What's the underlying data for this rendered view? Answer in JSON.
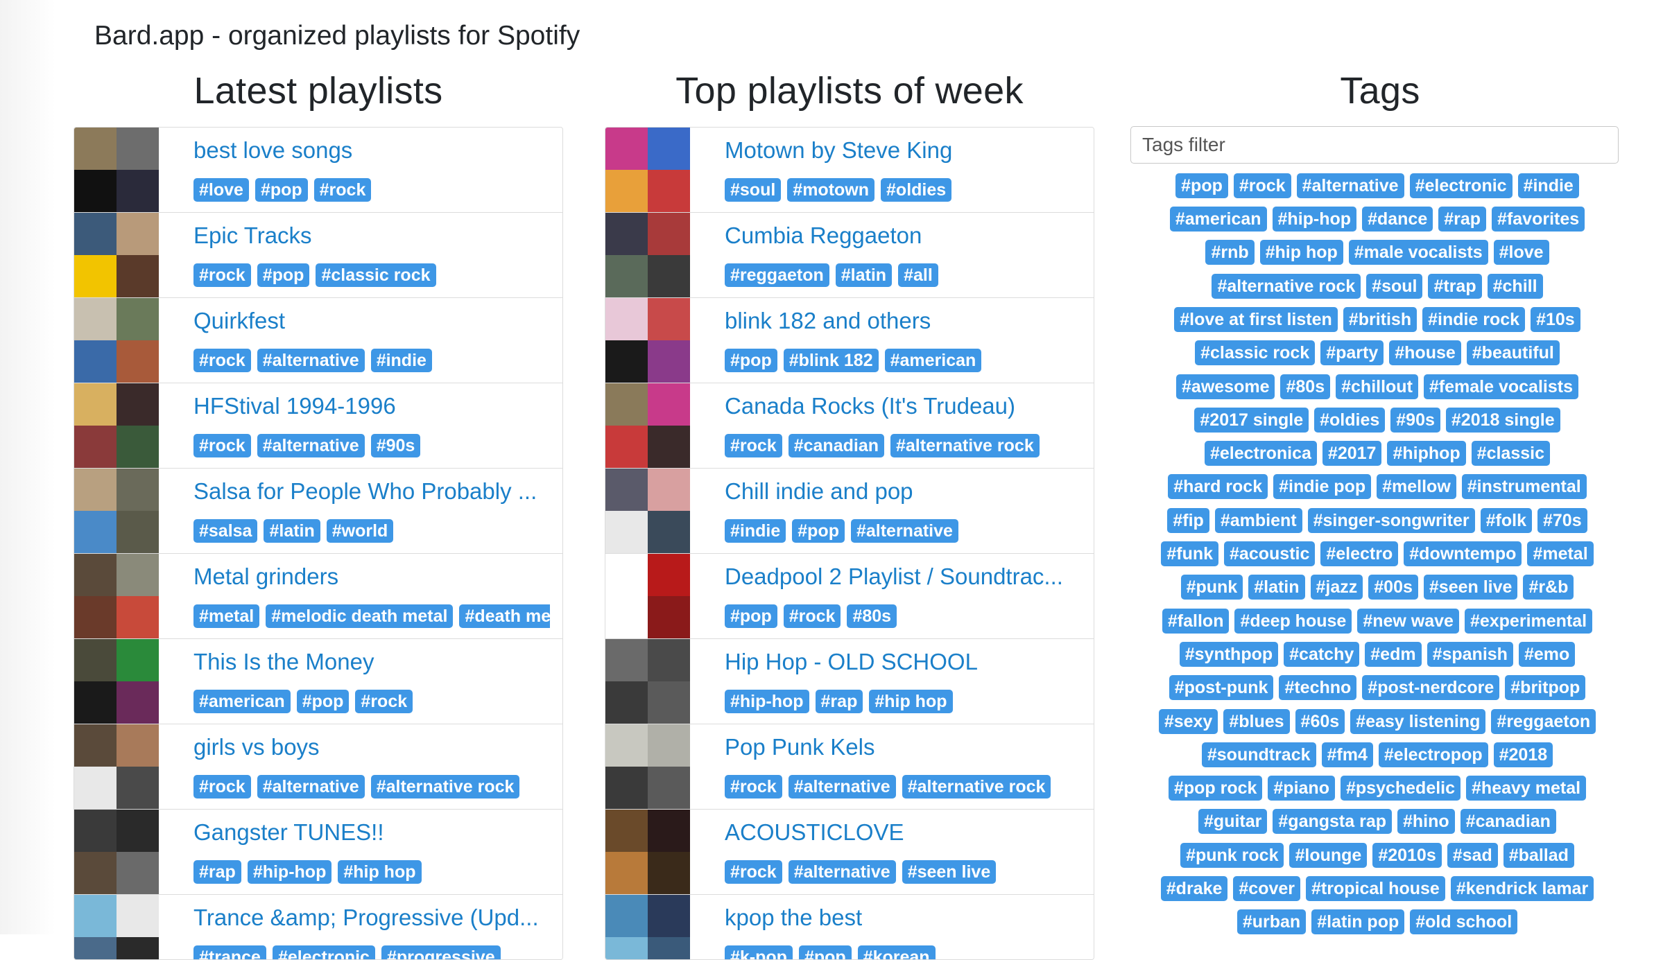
{
  "app": {
    "brand": "Bard.app - organized playlists for Spotify"
  },
  "latest": {
    "title": "Latest playlists",
    "items": [
      {
        "title": "best love songs",
        "tags": [
          "#love",
          "#pop",
          "#rock"
        ],
        "colors": [
          "#8c7a5a",
          "#6d6d6d",
          "#111111",
          "#2a2a3a"
        ]
      },
      {
        "title": "Epic Tracks",
        "tags": [
          "#rock",
          "#pop",
          "#classic rock"
        ],
        "colors": [
          "#3c5a7a",
          "#b89a7a",
          "#f2c400",
          "#5a3a2a"
        ]
      },
      {
        "title": "Quirkfest",
        "tags": [
          "#rock",
          "#alternative",
          "#indie"
        ],
        "colors": [
          "#c8c0b0",
          "#6a7a5a",
          "#3a6aa8",
          "#a85a3a"
        ]
      },
      {
        "title": "HFStival 1994-1996",
        "tags": [
          "#rock",
          "#alternative",
          "#90s"
        ],
        "colors": [
          "#d8b060",
          "#3a2a2a",
          "#8a3a3a",
          "#3a5a3a"
        ]
      },
      {
        "title": "Salsa for People Who Probably ...",
        "tags": [
          "#salsa",
          "#latin",
          "#world"
        ],
        "colors": [
          "#b8a080",
          "#6a6a5a",
          "#4a8ac8",
          "#5a5a4a"
        ]
      },
      {
        "title": "Metal grinders",
        "tags": [
          "#metal",
          "#melodic death metal",
          "#death metal"
        ],
        "colors": [
          "#5a4a3a",
          "#8a8a7a",
          "#6a3a2a",
          "#c84a3a"
        ]
      },
      {
        "title": "This Is the Money",
        "tags": [
          "#american",
          "#pop",
          "#rock"
        ],
        "colors": [
          "#4a4a3a",
          "#2a8a3a",
          "#1a1a1a",
          "#6a2a5a"
        ]
      },
      {
        "title": "girls vs boys",
        "tags": [
          "#rock",
          "#alternative",
          "#alternative rock"
        ],
        "colors": [
          "#5a4a3a",
          "#a87a5a",
          "#e8e8e8",
          "#4a4a4a"
        ]
      },
      {
        "title": "Gangster TUNES!!",
        "tags": [
          "#rap",
          "#hip-hop",
          "#hip hop"
        ],
        "colors": [
          "#3a3a3a",
          "#2a2a2a",
          "#5a4a3a",
          "#6a6a6a"
        ]
      },
      {
        "title": "Trance &amp; Progressive (Upd...",
        "tags": [
          "#trance",
          "#electronic",
          "#progressive"
        ],
        "colors": [
          "#7ab8d8",
          "#e8e8e8",
          "#4a6a8a",
          "#2a2a2a"
        ]
      }
    ]
  },
  "top": {
    "title": "Top playlists of week",
    "items": [
      {
        "title": "Motown by Steve King",
        "tags": [
          "#soul",
          "#motown",
          "#oldies"
        ],
        "colors": [
          "#c83a8a",
          "#3a6ac8",
          "#e8a03a",
          "#c83a3a"
        ]
      },
      {
        "title": "Cumbia Reggaeton",
        "tags": [
          "#reggaeton",
          "#latin",
          "#all"
        ],
        "colors": [
          "#3a3a4a",
          "#a83a3a",
          "#5a6a5a",
          "#3a3a3a"
        ]
      },
      {
        "title": "blink 182 and others",
        "tags": [
          "#pop",
          "#blink 182",
          "#american"
        ],
        "colors": [
          "#e8c8d8",
          "#c84a4a",
          "#1a1a1a",
          "#8a3a8a"
        ]
      },
      {
        "title": "Canada Rocks (It's Trudeau)",
        "tags": [
          "#rock",
          "#canadian",
          "#alternative rock"
        ],
        "colors": [
          "#8a7a5a",
          "#c83a8a",
          "#c83a3a",
          "#3a2a2a"
        ]
      },
      {
        "title": "Chill indie and pop",
        "tags": [
          "#indie",
          "#pop",
          "#alternative"
        ],
        "colors": [
          "#5a5a6a",
          "#d8a0a0",
          "#e8e8e8",
          "#3a4a5a"
        ]
      },
      {
        "title": "Deadpool 2 Playlist / Soundtrac...",
        "tags": [
          "#pop",
          "#rock",
          "#80s"
        ],
        "colors": [
          "#ffffff",
          "#b81a1a",
          "#ffffff",
          "#8a1a1a"
        ]
      },
      {
        "title": "Hip Hop - OLD SCHOOL",
        "tags": [
          "#hip-hop",
          "#rap",
          "#hip hop"
        ],
        "colors": [
          "#6a6a6a",
          "#4a4a4a",
          "#3a3a3a",
          "#5a5a5a"
        ]
      },
      {
        "title": "Pop Punk Kels",
        "tags": [
          "#rock",
          "#alternative",
          "#alternative rock"
        ],
        "colors": [
          "#c8c8c0",
          "#b0b0a8",
          "#3a3a3a",
          "#5a5a5a"
        ]
      },
      {
        "title": "ACOUSTICLOVE",
        "tags": [
          "#rock",
          "#alternative",
          "#seen live"
        ],
        "colors": [
          "#6a4a2a",
          "#2a1a1a",
          "#b87a3a",
          "#3a2a1a"
        ]
      },
      {
        "title": "kpop the best",
        "tags": [
          "#k-pop",
          "#pop",
          "#korean"
        ],
        "colors": [
          "#4a8ab8",
          "#2a3a5a",
          "#7ab8d8",
          "#3a5a7a"
        ]
      }
    ]
  },
  "tags": {
    "title": "Tags",
    "filter_placeholder": "Tags filter",
    "lines": [
      [
        "#pop",
        "#rock",
        "#alternative",
        "#electronic",
        "#indie"
      ],
      [
        "#american",
        "#hip-hop",
        "#dance",
        "#rap",
        "#favorites"
      ],
      [
        "#rnb",
        "#hip hop",
        "#male vocalists",
        "#love"
      ],
      [
        "#alternative rock",
        "#soul",
        "#trap",
        "#chill"
      ],
      [
        "#love at first listen",
        "#british",
        "#indie rock",
        "#10s"
      ],
      [
        "#classic rock",
        "#party",
        "#house",
        "#beautiful"
      ],
      [
        "#awesome",
        "#80s",
        "#chillout",
        "#female vocalists"
      ],
      [
        "#2017 single",
        "#oldies",
        "#90s",
        "#2018 single"
      ],
      [
        "#electronica",
        "#2017",
        "#hiphop",
        "#classic"
      ],
      [
        "#hard rock",
        "#indie pop",
        "#mellow",
        "#instrumental"
      ],
      [
        "#fip",
        "#ambient",
        "#singer-songwriter",
        "#folk",
        "#70s"
      ],
      [
        "#funk",
        "#acoustic",
        "#electro",
        "#downtempo",
        "#metal"
      ],
      [
        "#punk",
        "#latin",
        "#jazz",
        "#00s",
        "#seen live",
        "#r&b"
      ],
      [
        "#fallon",
        "#deep house",
        "#new wave",
        "#experimental"
      ],
      [
        "#synthpop",
        "#catchy",
        "#edm",
        "#spanish",
        "#emo"
      ],
      [
        "#post-punk",
        "#techno",
        "#post-nerdcore",
        "#britpop"
      ],
      [
        "#sexy",
        "#blues",
        "#60s",
        "#easy listening",
        "#reggaeton"
      ],
      [
        "#soundtrack",
        "#fm4",
        "#electropop",
        "#2018"
      ],
      [
        "#pop rock",
        "#piano",
        "#psychedelic",
        "#heavy metal"
      ],
      [
        "#guitar",
        "#gangsta rap",
        "#hino",
        "#canadian"
      ],
      [
        "#punk rock",
        "#lounge",
        "#2010s",
        "#sad",
        "#ballad"
      ],
      [
        "#drake",
        "#cover",
        "#tropical house",
        "#kendrick lamar"
      ],
      [
        "#urban",
        "#latin pop",
        "#old school"
      ]
    ]
  }
}
